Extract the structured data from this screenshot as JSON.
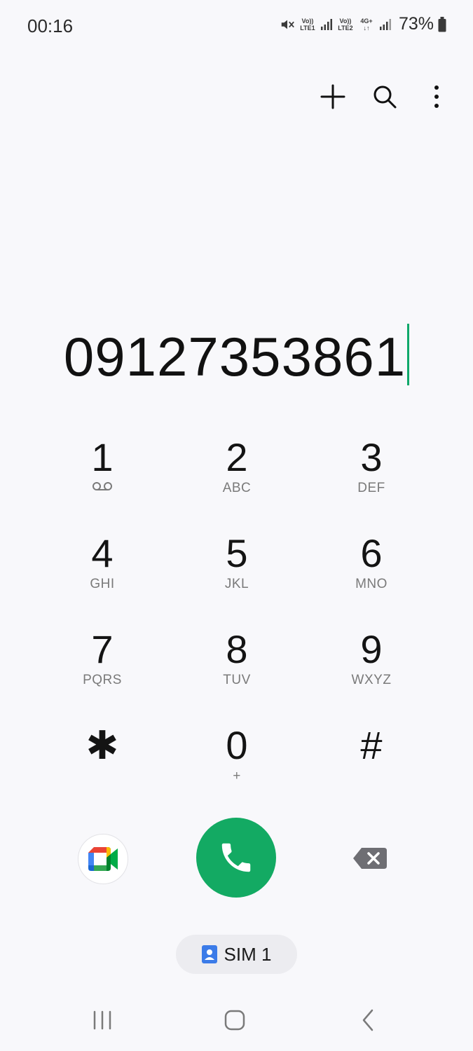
{
  "status_bar": {
    "time": "00:16",
    "sim1_top": "Vo))",
    "sim1_bottom": "LTE1",
    "sim2_top": "Vo))",
    "sim2_bottom": "LTE2",
    "data_type": "4G+",
    "battery": "73%",
    "icons": [
      "mute-icon",
      "signal-icon",
      "signal-icon",
      "data-arrows-icon",
      "signal-icon",
      "battery-icon"
    ]
  },
  "top_actions": [
    "add-contact-icon",
    "search-icon",
    "more-options-icon"
  ],
  "dialer": {
    "number": "09127353861",
    "accent_color": "#0fa86a"
  },
  "keypad": [
    {
      "digit": "1",
      "letters": "",
      "icon": "voicemail-icon"
    },
    {
      "digit": "2",
      "letters": "ABC"
    },
    {
      "digit": "3",
      "letters": "DEF"
    },
    {
      "digit": "4",
      "letters": "GHI"
    },
    {
      "digit": "5",
      "letters": "JKL"
    },
    {
      "digit": "6",
      "letters": "MNO"
    },
    {
      "digit": "7",
      "letters": "PQRS"
    },
    {
      "digit": "8",
      "letters": "TUV"
    },
    {
      "digit": "9",
      "letters": "WXYZ"
    },
    {
      "digit": "✱",
      "letters": ""
    },
    {
      "digit": "0",
      "letters": "+"
    },
    {
      "digit": "#",
      "letters": ""
    }
  ],
  "bottom_actions": {
    "video_call_icon": "google-meet-icon",
    "call_icon": "phone-icon",
    "call_color": "#13aa63",
    "delete_icon": "backspace-icon"
  },
  "sim_selector": {
    "label": "SIM 1",
    "icon": "sim-contact-icon",
    "icon_color": "#3b7be8"
  },
  "nav_bar": [
    "recents-icon",
    "home-icon",
    "back-icon"
  ]
}
